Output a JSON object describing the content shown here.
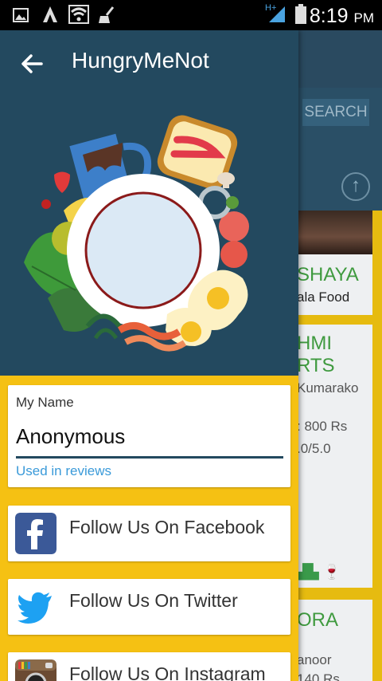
{
  "status_bar": {
    "time": "8:19",
    "ampm": "PM",
    "network_label": "H+",
    "icons": [
      "image-icon",
      "font-icon",
      "wifi-icon",
      "broom-icon",
      "signal-icon",
      "battery-icon"
    ]
  },
  "colors": {
    "drawer_header_bg": "#23495f",
    "drawer_bg": "#f5c113",
    "hint_blue": "#3a9ad9",
    "facebook": "#3b5998",
    "twitter": "#1da1f2"
  },
  "drawer": {
    "title": "HungryMeNot",
    "name_card": {
      "label": "My Name",
      "value": "Anonymous",
      "hint": "Used in reviews"
    },
    "social": [
      {
        "label": "Follow Us On Facebook",
        "icon": "facebook-icon"
      },
      {
        "label": "Follow Us On Twitter",
        "icon": "twitter-icon"
      },
      {
        "label": "Follow Us On Instagram",
        "icon": "instagram-icon"
      }
    ]
  },
  "background": {
    "search_label": "SEARCH",
    "cards": [
      {
        "name": "SHAYA",
        "line1": "ala Food"
      },
      {
        "name1": "HMI",
        "name2": "RTS",
        "line1": "Kumarako",
        "price": ": 800 Rs",
        "rating": ".0/5.0"
      },
      {
        "name": "ORA",
        "line1": "anoor",
        "price": "140 Rs"
      }
    ]
  }
}
